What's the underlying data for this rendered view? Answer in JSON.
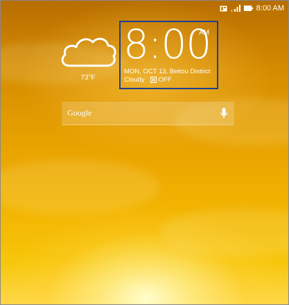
{
  "status_bar": {
    "time": "8:00 AM",
    "icons": [
      "notification-icon",
      "signal-icon",
      "battery-icon"
    ]
  },
  "weather_widget": {
    "icon": "cloud-icon",
    "temperature": "73°F"
  },
  "clock_widget": {
    "time": "8:00",
    "ampm": "AM",
    "date_location": "MON, OCT 13, Beitou District",
    "condition": "Cloudy",
    "alarm_status": "OFF"
  },
  "search_bar": {
    "logo": "Google",
    "mic_icon": "microphone-icon"
  },
  "colors": {
    "clock_highlight": "#1d3f8f",
    "text": "#ffffff"
  }
}
